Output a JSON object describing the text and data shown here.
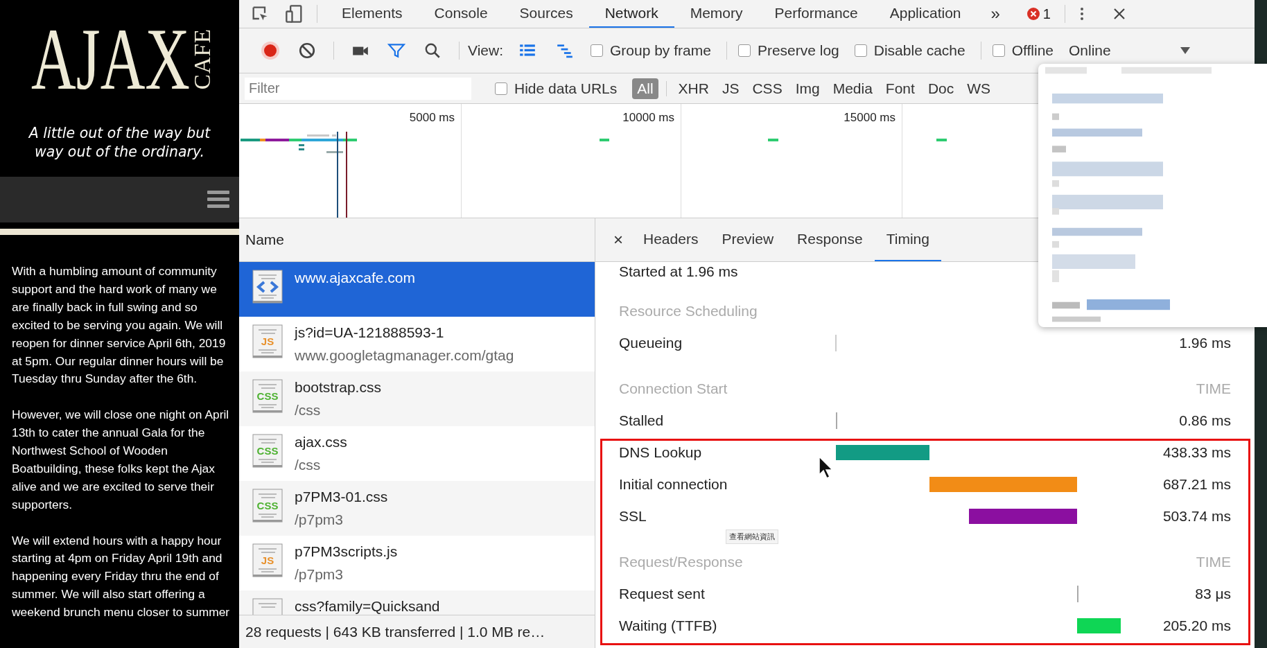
{
  "site": {
    "logo": "AJAX",
    "logo_side": "CAFE",
    "tagline": "A little out of the way but way out of the ordinary.",
    "paragraphs": [
      "With a humbling amount of community support and the hard work of many we are finally back in full swing and so excited to be serving you again. We will reopen for dinner service April 6th, 2019 at 5pm. Our regular dinner hours will be Tuesday thru Sunday after the 6th.",
      "However, we will close one night on April 13th to cater the annual Gala for the Northwest School of Wooden Boatbuilding, these folks kept the Ajax alive and we are excited to serve their supporters.",
      "We will extend hours with a happy hour starting at 4pm on Friday April 19th and happening every Friday thru the end of summer. We will also start offering a weekend brunch menu closer to summer"
    ]
  },
  "devtools": {
    "tabs": [
      {
        "label": "Elements",
        "selected": false
      },
      {
        "label": "Console",
        "selected": false
      },
      {
        "label": "Sources",
        "selected": false
      },
      {
        "label": "Network",
        "selected": true
      },
      {
        "label": "Memory",
        "selected": false
      },
      {
        "label": "Performance",
        "selected": false
      },
      {
        "label": "Application",
        "selected": false
      }
    ],
    "more_tabs": "»",
    "error_count": "1",
    "toolbar": {
      "recording": true,
      "view_label": "View:",
      "view_modes": [
        {
          "kind": "list",
          "on": true
        },
        {
          "kind": "waterfall",
          "on": true
        }
      ],
      "checkboxes": [
        {
          "label": "Group by frame",
          "checked": false
        },
        {
          "label": "Preserve log",
          "checked": false
        },
        {
          "label": "Disable cache",
          "checked": false
        },
        {
          "label": "Offline",
          "checked": false
        }
      ],
      "throttling": "Online"
    },
    "filter": {
      "placeholder": "Filter",
      "hide_data_urls": {
        "label": "Hide data URLs",
        "checked": false
      },
      "types": [
        {
          "label": "All",
          "selected": true
        },
        {
          "label": "XHR",
          "selected": false
        },
        {
          "label": "JS",
          "selected": false
        },
        {
          "label": "CSS",
          "selected": false
        },
        {
          "label": "Img",
          "selected": false
        },
        {
          "label": "Media",
          "selected": false
        },
        {
          "label": "Font",
          "selected": false
        },
        {
          "label": "Doc",
          "selected": false
        },
        {
          "label": "WS",
          "selected": false
        }
      ]
    },
    "overview": {
      "ticks": [
        "5000 ms",
        "10000 ms",
        "15000 ms"
      ]
    },
    "requests": {
      "header": "Name",
      "rows": [
        {
          "kind": "html",
          "name": "www.ajaxcafe.com",
          "selected": true
        },
        {
          "kind": "js",
          "icon_text": "JS",
          "name": "js?id=UA-121888593-1",
          "path": "www.googletagmanager.com/gtag",
          "selected": false
        },
        {
          "kind": "css",
          "icon_text": "CSS",
          "name": "bootstrap.css",
          "path": "/css",
          "selected": false
        },
        {
          "kind": "css",
          "icon_text": "CSS",
          "name": "ajax.css",
          "path": "/css",
          "selected": false
        },
        {
          "kind": "css",
          "icon_text": "CSS",
          "name": "p7PM3-01.css",
          "path": "/p7pm3",
          "selected": false
        },
        {
          "kind": "js",
          "icon_text": "JS",
          "name": "p7PM3scripts.js",
          "path": "/p7pm3",
          "selected": false
        },
        {
          "kind": "document",
          "name": "css?family=Quicksand",
          "selected": false
        }
      ],
      "summary": "28 requests | 643 KB transferred | 1.0 MB re…"
    },
    "detail": {
      "close": "×",
      "tabs": [
        {
          "label": "Headers",
          "selected": false
        },
        {
          "label": "Preview",
          "selected": false
        },
        {
          "label": "Response",
          "selected": false
        },
        {
          "label": "Timing",
          "selected": true
        }
      ],
      "started": "Started at 1.96 ms",
      "sections": [
        {
          "title": "Resource Scheduling",
          "rows": [
            {
              "label": "Queueing",
              "time": "1.96 ms",
              "color": "#cccccc"
            }
          ]
        },
        {
          "title": "Connection Start",
          "time_header": "TIME",
          "rows": [
            {
              "label": "Stalled",
              "time": "0.86 ms",
              "color": "#aaaaaa"
            },
            {
              "label": "DNS Lookup",
              "time": "438.33 ms",
              "color": "#129b84"
            },
            {
              "label": "Initial connection",
              "time": "687.21 ms",
              "color": "#f28c16"
            },
            {
              "label": "SSL",
              "time": "503.74 ms",
              "color": "#8b0fa0"
            }
          ]
        },
        {
          "title": "Request/Response",
          "time_header": "TIME",
          "rows": [
            {
              "label": "Request sent",
              "time": "83 μs",
              "color": "#aaaaaa"
            },
            {
              "label": "Waiting (TTFB)",
              "time": "205.20 ms",
              "color": "#0fd655"
            }
          ]
        }
      ],
      "tooltip": "查看網站資訊"
    }
  }
}
